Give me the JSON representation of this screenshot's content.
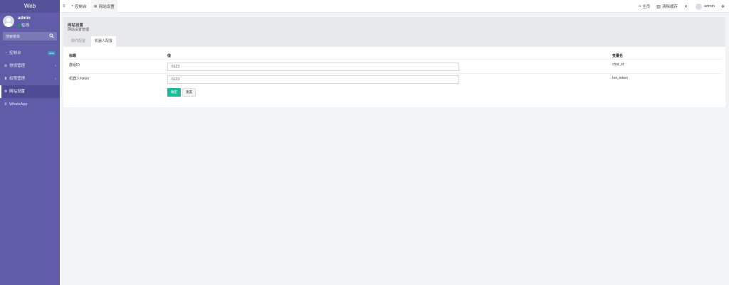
{
  "sidebar": {
    "brand": "Web",
    "user": {
      "name": "admin",
      "status": "在线"
    },
    "search_placeholder": "搜索菜单",
    "items": [
      {
        "label": "控制台",
        "icon": "dashboard-icon",
        "badge": "new"
      },
      {
        "label": "常规管理",
        "icon": "gear-icon"
      },
      {
        "label": "权限管理",
        "icon": "group-icon"
      },
      {
        "label": "网站设置",
        "icon": "cogs-icon",
        "active": true
      },
      {
        "label": "WhatsApp",
        "icon": "whatsapp-icon"
      }
    ]
  },
  "topnav": {
    "items": [
      {
        "label": "控制台",
        "icon": "dashboard-icon"
      },
      {
        "label": "网站设置",
        "icon": "cogs-icon"
      }
    ],
    "right": {
      "home": "主页",
      "clear_cache": "清除缓存",
      "user": "admin"
    }
  },
  "page": {
    "title": "网站设置",
    "subtitle": "网站设置管理",
    "tabs": [
      "邮件配置",
      "机器人配置"
    ]
  },
  "table": {
    "headers": {
      "title": "标题",
      "value": "值",
      "varname": "变量名"
    },
    "rows": [
      {
        "title": "群组ID",
        "value": "6123",
        "varname": "chat_id"
      },
      {
        "title": "机器人Token",
        "value": "6123",
        "varname": "bot_token"
      }
    ],
    "ok_label": "确定",
    "reset_label": "重置"
  },
  "colors": {
    "sidebar": "#605ca8",
    "accent": "#18bc9c"
  }
}
